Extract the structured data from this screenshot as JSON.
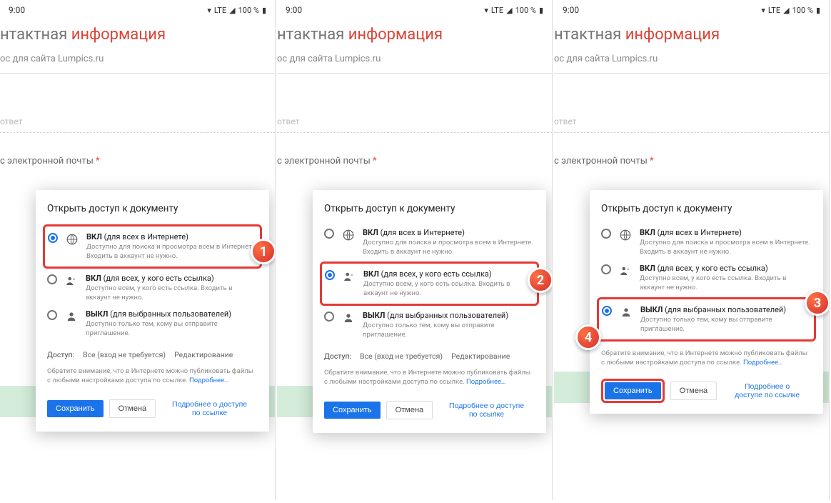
{
  "statusbar": {
    "time": "9:00",
    "lte": "LTE",
    "battery": "100 %"
  },
  "form": {
    "title_prefix": "нтактная ",
    "title_red": "информация",
    "subtitle": "ос для сайта Lumpics.ru",
    "answer_hint": "ответ",
    "email_label": "с электронной почты",
    "required": "*"
  },
  "dialog": {
    "title": "Открыть доступ к документу",
    "options": [
      {
        "title_bold": "ВКЛ",
        "title_rest": " (для всех в Интернете)",
        "desc": "Доступно для поиска и просмотра всем в Интернете. Входить в аккаунт не нужно."
      },
      {
        "title_bold": "ВКЛ",
        "title_rest": " (для всех, у кого есть ссылка)",
        "desc": "Доступно всем, у кого есть ссылка. Входить в аккаунт не нужно."
      },
      {
        "title_bold": "ВЫКЛ",
        "title_rest": " (для выбранных пользователей)",
        "desc": "Доступно только тем, кому вы отправите приглашение."
      }
    ],
    "access_label": "Доступ:",
    "access_who": "Все (вход не требуется)",
    "access_mode": "Редактирование",
    "note_text": "Обратите внимание, что в Интернете можно публиковать файлы с любыми настройками доступа по ссылке. ",
    "note_link": "Подробнее…",
    "save": "Сохранить",
    "cancel": "Отмена",
    "more_link": "Подробнее о доступе по ссылке"
  },
  "badges": {
    "b1": "1",
    "b2": "2",
    "b3": "3",
    "b4": "4"
  }
}
